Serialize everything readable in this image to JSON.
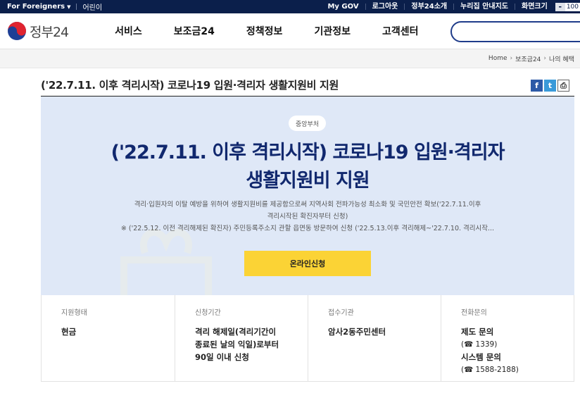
{
  "topbar": {
    "foreigners": "For Foreigners",
    "kids": "어린이",
    "links": [
      "My GOV",
      "로그아웃",
      "정부24소개",
      "누리집 안내지도",
      "화면크기"
    ],
    "zoom_minus": "-",
    "zoom_value": "100"
  },
  "header": {
    "logo_text": "정부24",
    "menu": [
      "서비스",
      "보조금24",
      "정책정보",
      "기관정보",
      "고객센터"
    ]
  },
  "breadcrumb": [
    "Home",
    "보조금24",
    "나의 혜택"
  ],
  "page_title": "('22.7.11. 이후 격리시작) 코로나19 입원·격리자 생활지원비 지원",
  "share": {
    "facebook": "f",
    "twitter": "t",
    "print": "⎙"
  },
  "hero": {
    "badge": "중앙부처",
    "title_line1": "('22.7.11. 이후 격리시작) 코로나19 입원·격리자",
    "title_line2": "생활지원비 지원",
    "desc_line1": "격리·입원자의 이탈 예방을 위하여 생활지원비를 제공함으로써 지역사회 전파가능성 최소화 및 국민안전 확보('22.7.11.이후",
    "desc_line2": "격리시작된 확진자부터 신청)",
    "desc_line3": "※ ('22.5.12. 이전 격리해제된 확진자) 주민등록주소지 관할 읍면동 방문하여 신청 ('22.5.13.이후 격리해제~'22.7.10. 격리시작...",
    "apply_label": "온라인신청"
  },
  "info": {
    "support_type": {
      "label": "지원형태",
      "value": "현금"
    },
    "apply_period": {
      "label": "신청기간",
      "value_lines": [
        "격리 해제일(격리기간이",
        "종료된 날의 익일)로부터",
        "90일 이내 신청"
      ]
    },
    "agency": {
      "label": "접수기관",
      "value": "암사2동주민센터"
    },
    "contact": {
      "label": "전화문의",
      "line1": "제도 문의",
      "line2": "(☎ 1339)",
      "line3": "시스템 문의",
      "line4": "(☎ 1588-2188)"
    }
  },
  "colors": {
    "navy": "#0b1f4b",
    "accent": "#11286e",
    "hero_bg": "#dfe8f7",
    "button": "#fbd335"
  }
}
